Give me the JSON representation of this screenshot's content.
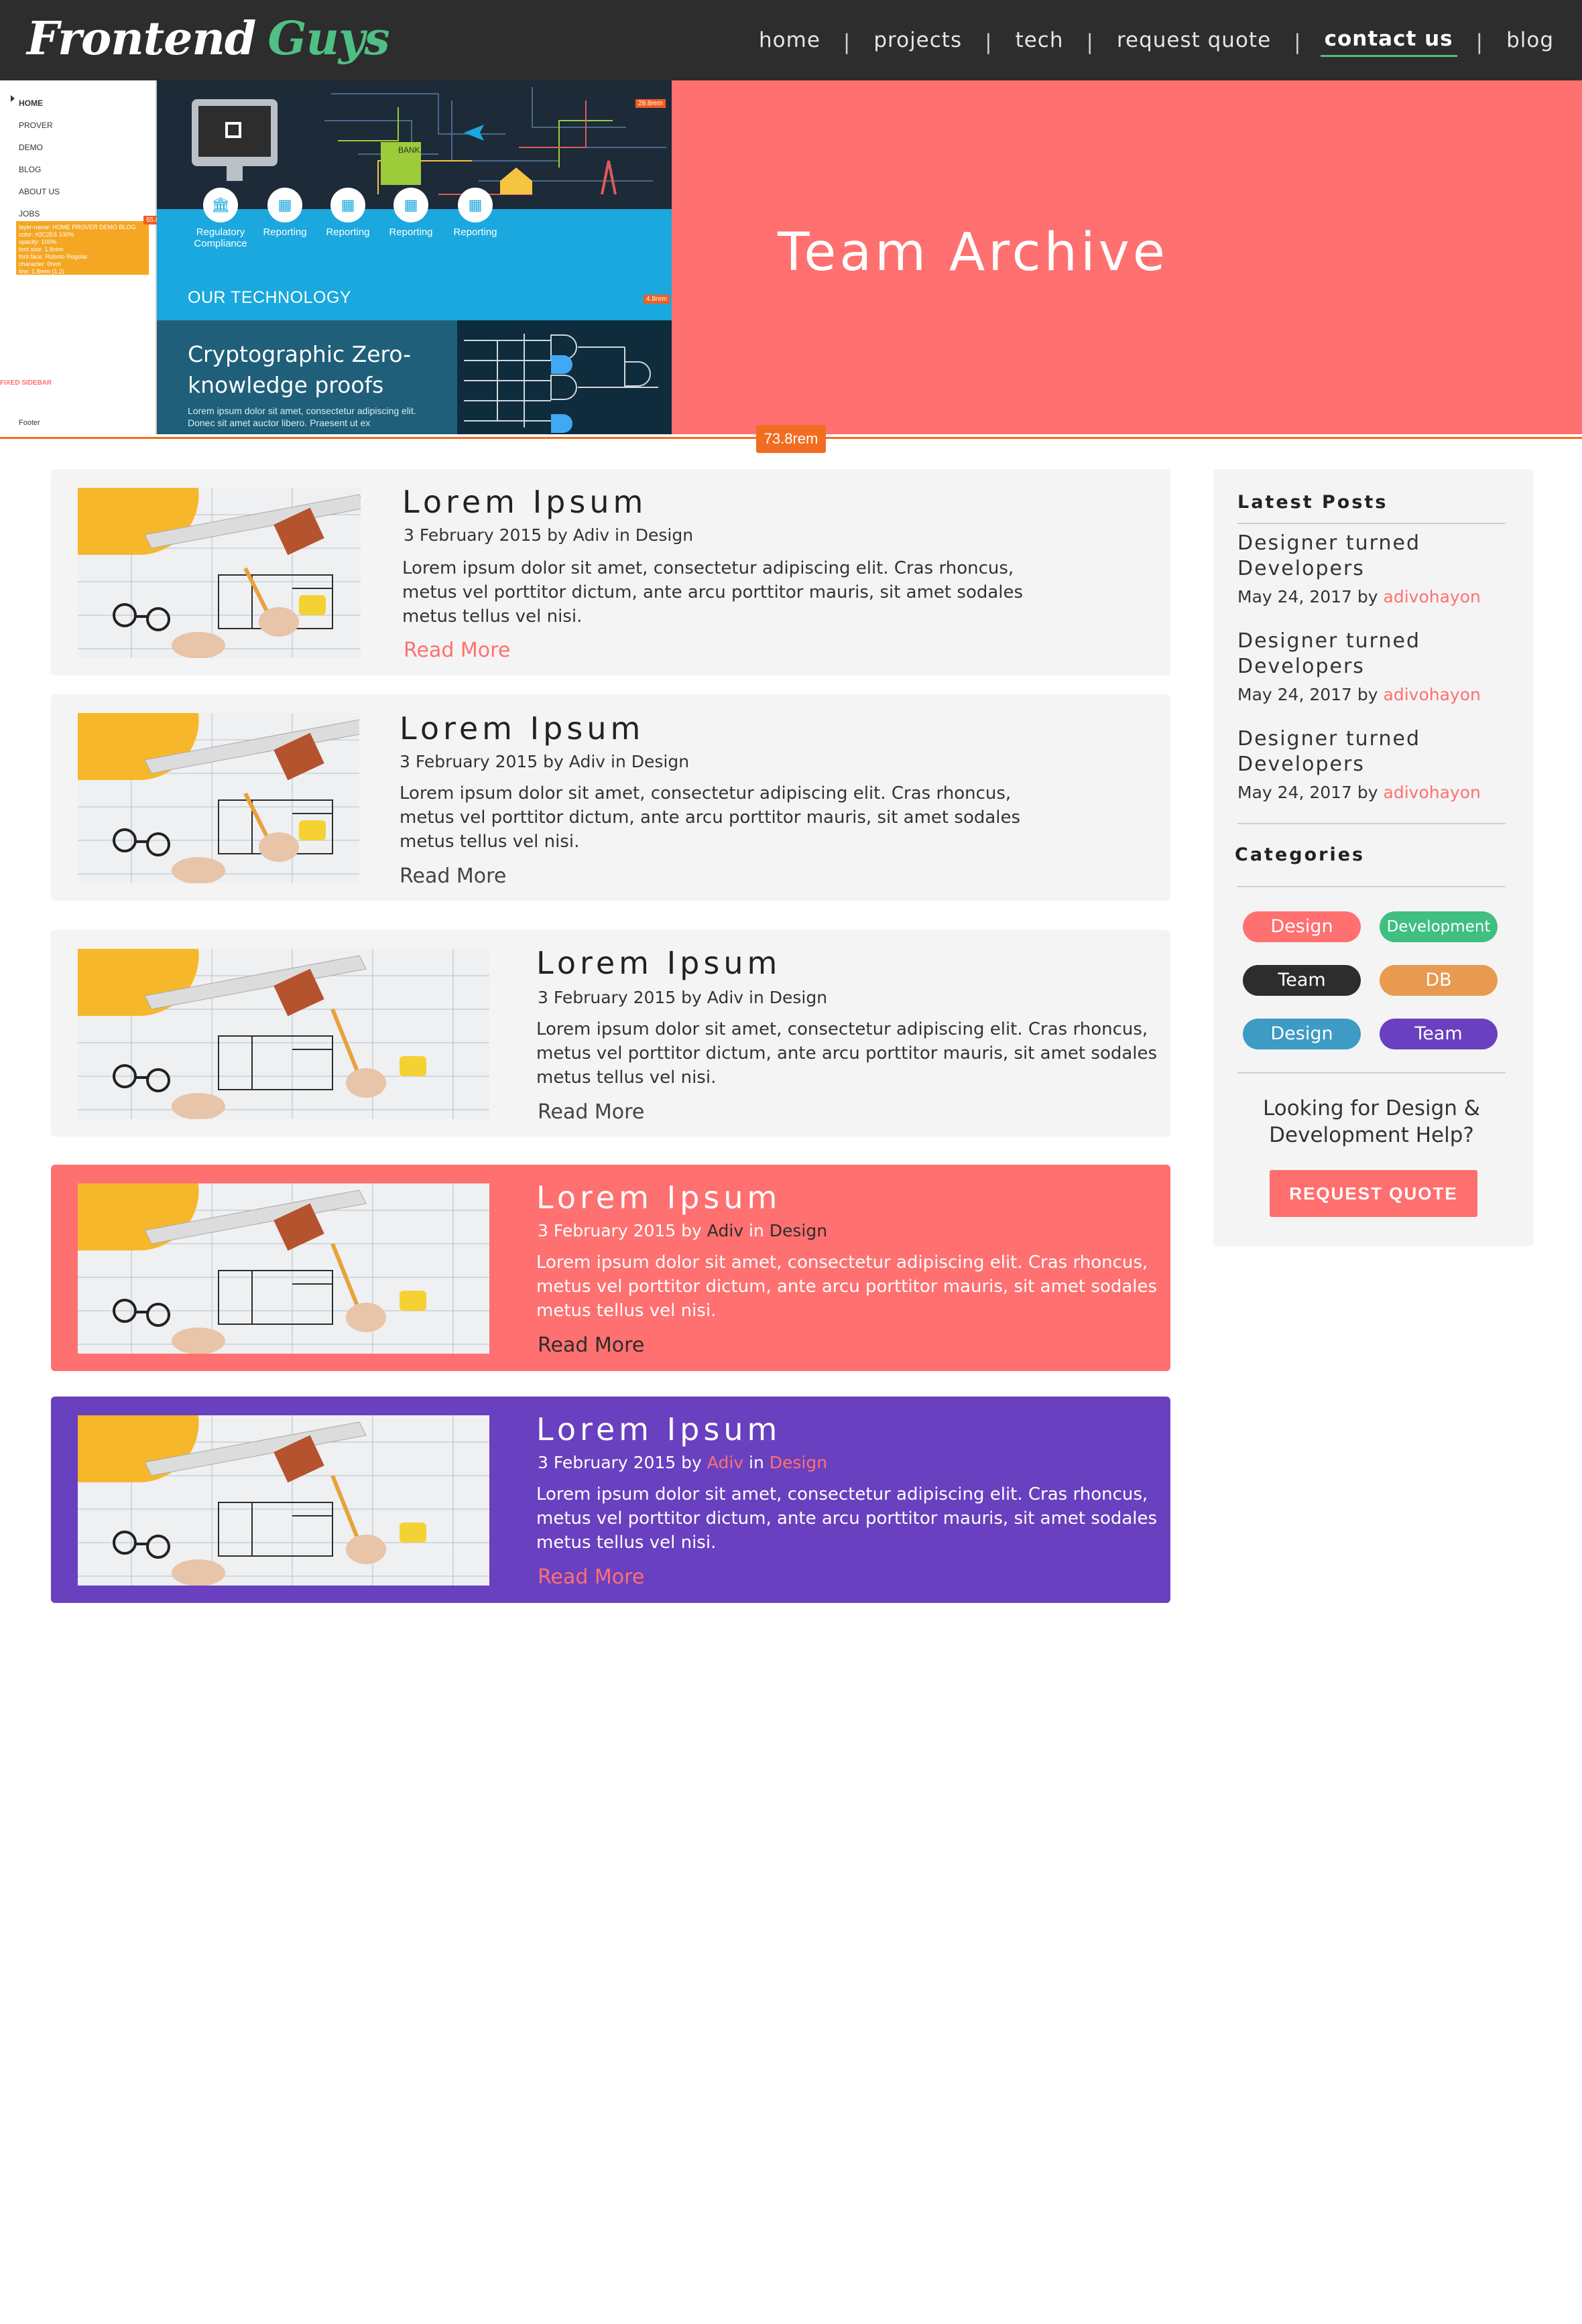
{
  "brand": {
    "word1": "Frontend",
    "word2": "Guys"
  },
  "nav": {
    "items": [
      {
        "label": "home"
      },
      {
        "label": "projects"
      },
      {
        "label": "tech"
      },
      {
        "label": "request quote"
      },
      {
        "label": "contact us",
        "active": true
      },
      {
        "label": "blog"
      }
    ],
    "separator": "|"
  },
  "hero": {
    "title": "Team Archive",
    "measure_label": "73.8rem",
    "preview": {
      "menu": [
        "HOME",
        "PROVER",
        "DEMO",
        "BLOG",
        "ABOUT US",
        "JOBS"
      ],
      "orange_box": [
        "layer-name: HOME PROVER DEMO BLOG",
        "color: #2C2E6 100%",
        "opacity: 100%",
        "font size: 1.8rem",
        "font face: Roboto Regular",
        "character: 0rem",
        "line: 1.8rem (1.2)"
      ],
      "fixed_label": "FIXED SIDEBAR",
      "footer_label": "Footer",
      "tag_a": "65.8rem",
      "tag_b": "29.8rem",
      "tag_c": "4.8rem",
      "building_label": "BANK",
      "reports": [
        "Regulatory Compliance",
        "Reporting",
        "Reporting",
        "Reporting",
        "Reporting"
      ],
      "our_technology": "OUR TECHNOLOGY",
      "crypto_title": "Cryptographic Zero-knowledge proofs",
      "crypto_text": "Lorem ipsum dolor sit amet, consectetur adipiscing elit. Donec sit amet auctor libero. Praesent ut ex"
    }
  },
  "posts": [
    {
      "title": "Lorem Ipsum",
      "date": "3 February 2015",
      "by": "by",
      "author": "Adiv",
      "in": "in",
      "category": "Design",
      "excerpt": "Lorem ipsum dolor sit amet, consectetur adipiscing elit. Cras rhoncus, metus vel porttitor dictum, ante arcu porttitor mauris, sit amet sodales metus tellus vel nisi.",
      "more": "Read More"
    },
    {
      "title": "Lorem Ipsum",
      "date": "3 February 2015",
      "by": "by",
      "author": "Adiv",
      "in": "in",
      "category": "Design",
      "excerpt": "Lorem ipsum dolor sit amet, consectetur adipiscing elit. Cras rhoncus, metus vel porttitor dictum, ante arcu porttitor mauris, sit amet sodales metus tellus vel nisi.",
      "more": "Read More"
    },
    {
      "title": "Lorem Ipsum",
      "date": "3 February 2015",
      "by": "by",
      "author": "Adiv",
      "in": "in",
      "category": "Design",
      "excerpt": "Lorem ipsum dolor sit amet, consectetur adipiscing elit. Cras rhoncus, metus vel porttitor dictum, ante arcu porttitor mauris, sit amet sodales metus tellus vel nisi.",
      "more": "Read More"
    },
    {
      "title": "Lorem Ipsum",
      "date": "3 February 2015",
      "by": "by",
      "author": "Adiv",
      "in": "in",
      "category": "Design",
      "excerpt": "Lorem ipsum dolor sit amet, consectetur adipiscing elit. Cras rhoncus, metus vel porttitor dictum, ante arcu porttitor mauris, sit amet sodales metus tellus vel nisi.",
      "more": "Read More"
    },
    {
      "title": "Lorem Ipsum",
      "date": "3 February 2015",
      "by": "by",
      "author": "Adiv",
      "in": "in",
      "category": "Design",
      "excerpt": "Lorem ipsum dolor sit amet, consectetur adipiscing elit. Cras rhoncus, metus vel porttitor dictum, ante arcu porttitor mauris, sit amet sodales metus tellus vel nisi.",
      "more": "Read More"
    }
  ],
  "sidebar": {
    "latest_heading": "Latest Posts",
    "latest": [
      {
        "title": "Designer turned Developers",
        "date": "May 24, 2017",
        "by": "by",
        "author": "adivohayon"
      },
      {
        "title": "Designer turned Developers",
        "date": "May 24, 2017",
        "by": "by",
        "author": "adivohayon"
      },
      {
        "title": "Designer turned Developers",
        "date": "May 24, 2017",
        "by": "by",
        "author": "adivohayon"
      }
    ],
    "categories_heading": "Categories",
    "categories": [
      {
        "label": "Design",
        "color": "#ff7070"
      },
      {
        "label": "Development",
        "color": "#3fbf80"
      },
      {
        "label": "Team",
        "color": "#2d2d2d"
      },
      {
        "label": "DB",
        "color": "#e89a50"
      },
      {
        "label": "Design",
        "color": "#3d9bc4"
      },
      {
        "label": "Team",
        "color": "#6940bf"
      }
    ],
    "help_text": "Looking for Design & Development Help?",
    "quote_button": "REQUEST QUOTE"
  },
  "colors": {
    "header_bg": "#2d2d2d",
    "brand_green": "#4fbf84",
    "coral": "#ff7070",
    "purple": "#6940bf",
    "card_bg": "#f4f4f4",
    "measure_orange": "#f26d21"
  }
}
